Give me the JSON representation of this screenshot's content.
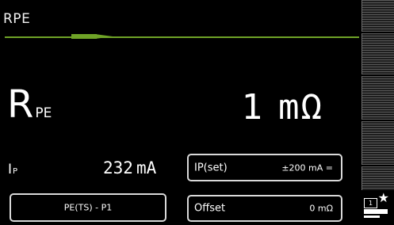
{
  "header": {
    "title": "RPE"
  },
  "measurement": {
    "symbol": "R",
    "symbol_sub": "PE",
    "value": "1",
    "unit": "mΩ"
  },
  "current": {
    "symbol": "I",
    "symbol_sub": "P",
    "value": "232",
    "unit": "mA"
  },
  "buttons": {
    "ip_set": {
      "label": "IP(set)",
      "value": "±200 mA ="
    },
    "offset": {
      "label": "Offset",
      "value": "0 mΩ"
    },
    "mode": {
      "label": "PE(TS) - P1"
    }
  },
  "side_panel": {
    "favorite_number": "1",
    "icons": [
      "star-icon"
    ]
  },
  "colors": {
    "accent": "#6fa327",
    "background": "#000000",
    "text": "#ffffff"
  }
}
